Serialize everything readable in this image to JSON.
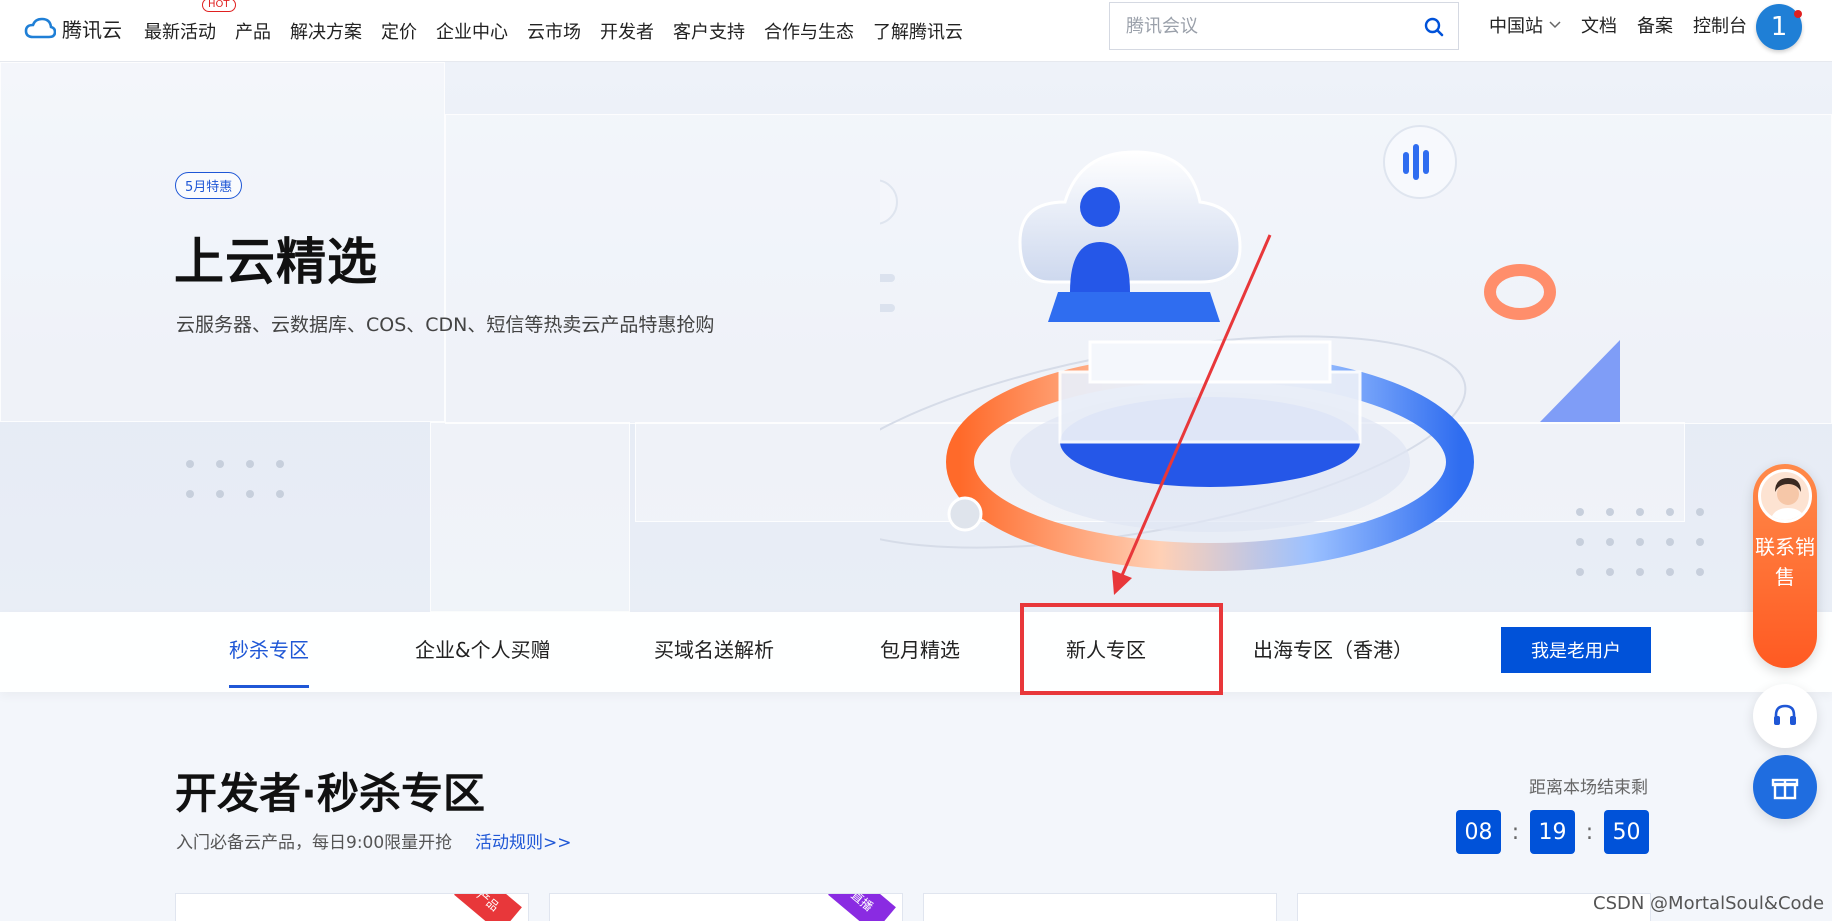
{
  "header": {
    "logo_text": "腾讯云",
    "nav": [
      "最新活动",
      "产品",
      "解决方案",
      "定价",
      "企业中心",
      "云市场",
      "开发者",
      "客户支持",
      "合作与生态",
      "了解腾讯云"
    ],
    "hot_badge": "HOT",
    "search_placeholder": "腾讯会议",
    "region": "中国站",
    "docs": "文档",
    "filing": "备案",
    "console": "控制台",
    "avatar_initial": "1"
  },
  "hero": {
    "badge": "5月特惠",
    "title": "上云精选",
    "subtitle": "云服务器、云数据库、COS、CDN、短信等热卖云产品特惠抢购"
  },
  "tabs": {
    "items": [
      "秒杀专区",
      "企业&个人买赠",
      "买域名送解析",
      "包月精选",
      "新人专区",
      "出海专区（香港）"
    ],
    "active_index": 0,
    "cta": "我是老用户"
  },
  "section": {
    "title": "开发者·秒杀专区",
    "subtitle": "入门必备云产品，每日9:00限量开抢",
    "rules_link": "活动规则>>",
    "countdown_label": "距离本场结束剩",
    "countdown": {
      "hours": "08",
      "minutes": "19",
      "seconds": "50"
    },
    "countdown_separator": ":"
  },
  "cards": [
    {
      "ribbon": "产品",
      "ribbon_color": "#e8373a"
    },
    {
      "ribbon": "直播",
      "ribbon_color": "#8a2be2"
    },
    {
      "ribbon": "",
      "ribbon_color": ""
    },
    {
      "ribbon": "",
      "ribbon_color": ""
    }
  ],
  "sidebar": {
    "sales_label": "联系销售"
  },
  "watermark": "CSDN @MortalSoul&Code",
  "colors": {
    "brand_blue": "#0052d9",
    "highlight_red": "#e8373a",
    "sales_orange": "#ff5a22"
  }
}
